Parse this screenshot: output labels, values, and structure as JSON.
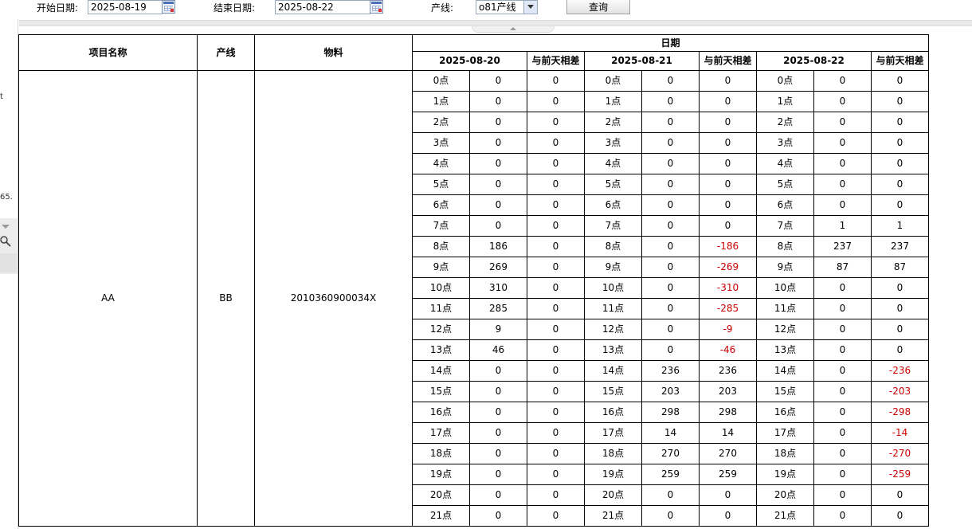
{
  "toolbar": {
    "start_label": "开始日期:",
    "start_value": "2025-08-19",
    "end_label": "结束日期:",
    "end_value": "2025-08-22",
    "line_label": "产线:",
    "line_value": "o81产线",
    "query_label": "查询"
  },
  "left_fragments": {
    "frag1": "t",
    "frag2": "65."
  },
  "table": {
    "headers": {
      "project": "项目名称",
      "line": "产线",
      "material": "物料",
      "date_group": "日期",
      "diff": "与前天相差"
    },
    "dates": [
      "2025-08-20",
      "2025-08-21",
      "2025-08-22"
    ],
    "project": "AA",
    "line": "BB",
    "material": "2010360900034X",
    "hours": [
      "0点",
      "1点",
      "2点",
      "3点",
      "4点",
      "5点",
      "6点",
      "7点",
      "8点",
      "9点",
      "10点",
      "11点",
      "12点",
      "13点",
      "14点",
      "15点",
      "16点",
      "17点",
      "18点",
      "19点",
      "20点",
      "21点"
    ],
    "rows": [
      [
        "0",
        "0",
        "0",
        "0",
        "0",
        "0"
      ],
      [
        "0",
        "0",
        "0",
        "0",
        "0",
        "0"
      ],
      [
        "0",
        "0",
        "0",
        "0",
        "0",
        "0"
      ],
      [
        "0",
        "0",
        "0",
        "0",
        "0",
        "0"
      ],
      [
        "0",
        "0",
        "0",
        "0",
        "0",
        "0"
      ],
      [
        "0",
        "0",
        "0",
        "0",
        "0",
        "0"
      ],
      [
        "0",
        "0",
        "0",
        "0",
        "0",
        "0"
      ],
      [
        "0",
        "0",
        "0",
        "0",
        "1",
        "1"
      ],
      [
        "186",
        "0",
        "0",
        "-186",
        "237",
        "237"
      ],
      [
        "269",
        "0",
        "0",
        "-269",
        "87",
        "87"
      ],
      [
        "310",
        "0",
        "0",
        "-310",
        "0",
        "0"
      ],
      [
        "285",
        "0",
        "0",
        "-285",
        "0",
        "0"
      ],
      [
        "9",
        "0",
        "0",
        "-9",
        "0",
        "0"
      ],
      [
        "46",
        "0",
        "0",
        "-46",
        "0",
        "0"
      ],
      [
        "0",
        "0",
        "236",
        "236",
        "0",
        "-236"
      ],
      [
        "0",
        "0",
        "203",
        "203",
        "0",
        "-203"
      ],
      [
        "0",
        "0",
        "298",
        "298",
        "0",
        "-298"
      ],
      [
        "0",
        "0",
        "14",
        "14",
        "0",
        "-14"
      ],
      [
        "0",
        "0",
        "270",
        "270",
        "0",
        "-270"
      ],
      [
        "0",
        "0",
        "259",
        "259",
        "0",
        "-259"
      ],
      [
        "0",
        "0",
        "0",
        "0",
        "0",
        "0"
      ],
      [
        "0",
        "0",
        "0",
        "0",
        "0",
        "0"
      ]
    ]
  },
  "colors": {
    "negative": "#cc0000"
  }
}
